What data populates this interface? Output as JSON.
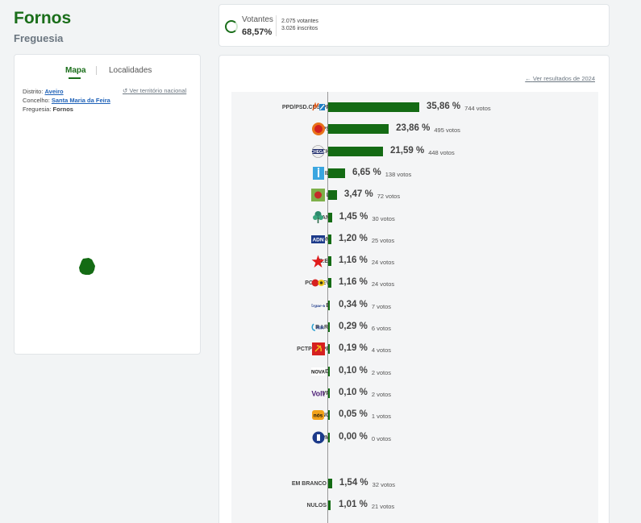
{
  "header": {
    "title": "Fornos",
    "subtitle": "Freguesia"
  },
  "votantes": {
    "label": "Votantes",
    "percent": "68,57%",
    "votantes_line": "2.075 votantes",
    "inscritos_line": "3.026 inscritos"
  },
  "map_panel": {
    "tabs": [
      "Mapa",
      "Localidades"
    ],
    "active_tab": "Mapa",
    "distrito_label": "Distrito:",
    "distrito": "Aveiro",
    "concelho_label": "Concelho:",
    "concelho": "Santa Maria da Feira",
    "freguesia_label": "Freguesia:",
    "freguesia": "Fornos",
    "ver_territorio": "Ver território nacional",
    "map_color": "#146b14"
  },
  "results": {
    "ver_resultados": "Ver resultados de 2024",
    "bar_color": "#146b14",
    "rows": [
      {
        "party": "PPD/PSD.CDS-PP",
        "percent": "35,86 %",
        "votes": "744 votos",
        "value": 35.86,
        "icon": "ad-logo-icon"
      },
      {
        "party": "PS",
        "percent": "23,86 %",
        "votes": "495 votos",
        "value": 23.86,
        "icon": "ps-logo-icon"
      },
      {
        "party": "CH",
        "percent": "21,59 %",
        "votes": "448 votos",
        "value": 21.59,
        "icon": "chega-logo-icon"
      },
      {
        "party": "IL",
        "percent": "6,65 %",
        "votes": "138 votos",
        "value": 6.65,
        "icon": "il-logo-icon"
      },
      {
        "party": "L",
        "percent": "3,47 %",
        "votes": "72 votos",
        "value": 3.47,
        "icon": "livre-logo-icon"
      },
      {
        "party": "PAN",
        "percent": "1,45 %",
        "votes": "30 votos",
        "value": 1.45,
        "icon": "pan-logo-icon"
      },
      {
        "party": "ADN",
        "percent": "1,20 %",
        "votes": "25 votos",
        "value": 1.2,
        "icon": "adn-logo-icon"
      },
      {
        "party": "B.E.",
        "percent": "1,16 %",
        "votes": "24 votos",
        "value": 1.16,
        "icon": "be-star-icon"
      },
      {
        "party": "PCP-PEV",
        "percent": "1,16 %",
        "votes": "24 votos",
        "value": 1.16,
        "icon": "cdu-logo-icon"
      },
      {
        "party": "E",
        "percent": "0,34 %",
        "votes": "7 votos",
        "value": 0.34,
        "icon": "ergue-te-logo-icon"
      },
      {
        "party": "R.I.R.",
        "percent": "0,29 %",
        "votes": "6 votos",
        "value": 0.29,
        "icon": "rir-logo-icon"
      },
      {
        "party": "PCTP/MRPP",
        "percent": "0,19 %",
        "votes": "4 votos",
        "value": 0.19,
        "icon": "pctp-logo-icon"
      },
      {
        "party": "ND",
        "percent": "0,10 %",
        "votes": "2 votos",
        "value": 0.1,
        "icon": "nd-logo-icon"
      },
      {
        "party": "VP",
        "percent": "0,10 %",
        "votes": "2 votos",
        "value": 0.1,
        "icon": "volt-logo-icon"
      },
      {
        "party": "NC",
        "percent": "0,05 %",
        "votes": "1 votos",
        "value": 0.05,
        "icon": "nc-logo-icon"
      },
      {
        "party": "PPM",
        "percent": "0,00 %",
        "votes": "0 votos",
        "value": 0.0,
        "icon": "ppm-logo-icon"
      },
      {
        "party": "EM BRANCO",
        "percent": "1,54 %",
        "votes": "32 votos",
        "value": 1.54,
        "icon": ""
      },
      {
        "party": "NULOS",
        "percent": "1,01 %",
        "votes": "21 votos",
        "value": 1.01,
        "icon": ""
      }
    ]
  }
}
